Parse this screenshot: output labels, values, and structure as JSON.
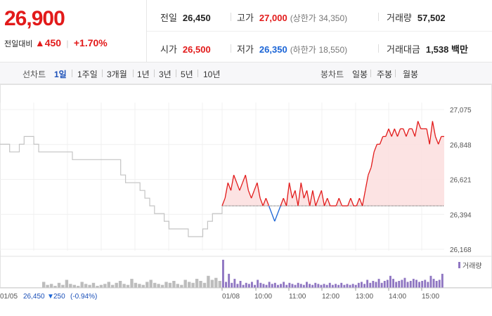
{
  "quote": {
    "current_price": "26,900",
    "change_label": "전일대비",
    "change_arrow": "▲",
    "change_value": "450",
    "change_pct": "+1.70%",
    "prev_close_label": "전일",
    "prev_close": "26,450",
    "high_label": "고가",
    "high": "27,000",
    "upper_limit_label": "(상한가",
    "upper_limit": "34,350)",
    "volume_label": "거래량",
    "volume": "57,502",
    "open_label": "시가",
    "open": "26,500",
    "low_label": "저가",
    "low": "26,350",
    "lower_limit_label": "(하한가",
    "lower_limit": "18,550)",
    "trade_value_label": "거래대금",
    "trade_value": "1,538 백만"
  },
  "tabs": {
    "line_label": "선차트",
    "line_items": [
      "1일",
      "1주일",
      "3개월",
      "1년",
      "3년",
      "5년",
      "10년"
    ],
    "active": "1일",
    "candle_label": "봉차트",
    "candle_items": [
      "일봉",
      "주봉",
      "월봉"
    ]
  },
  "colors": {
    "up": "#e21a1a",
    "down": "#1a64d6",
    "prev_day_line": "#c4c4c4",
    "volume_today": "#8f76c2",
    "volume_prev": "#bdbdbd",
    "fill_up": "#fbdede"
  },
  "chart_data": {
    "type": "line",
    "y_ticks": [
      "27,075",
      "26,848",
      "26,621",
      "26,394",
      "26,168"
    ],
    "ylim": [
      26168,
      27075
    ],
    "reference_price": 26450,
    "x_tick_labels": [
      "01/05",
      "01/08",
      "10:00",
      "11:00",
      "12:00",
      "13:00",
      "14:00",
      "15:00"
    ],
    "prev_day_summary": {
      "date": "01/05",
      "close": "26,450",
      "arrow": "▼",
      "change": "250",
      "pct": "(-0.94%)"
    },
    "volume_legend": "거래량",
    "prev_day_price": [
      26850,
      26850,
      26800,
      26800,
      26850,
      26900,
      26900,
      26850,
      26800,
      26800,
      26800,
      26800,
      26800,
      26800,
      26800,
      26750,
      26750,
      26750,
      26750,
      26750,
      26750,
      26750,
      26750,
      26750,
      26750,
      26650,
      26600,
      26600,
      26600,
      26550,
      26500,
      26450,
      26400,
      26400,
      26350,
      26300,
      26300,
      26300,
      26300,
      26250,
      26250,
      26250,
      26300,
      26350,
      26400,
      26400,
      26450
    ],
    "today_series": {
      "times": [
        "09:00",
        "09:05",
        "09:10",
        "09:15",
        "09:20",
        "09:25",
        "09:30",
        "09:35",
        "09:40",
        "09:45",
        "09:50",
        "09:55",
        "10:00",
        "10:05",
        "10:10",
        "10:15",
        "10:20",
        "10:25",
        "10:30",
        "10:35",
        "10:40",
        "10:45",
        "10:50",
        "10:55",
        "11:00",
        "11:05",
        "11:10",
        "11:15",
        "11:20",
        "11:25",
        "11:30",
        "11:35",
        "11:40",
        "11:45",
        "11:50",
        "11:55",
        "12:00",
        "12:05",
        "12:10",
        "12:15",
        "12:20",
        "12:25",
        "12:30",
        "12:35",
        "12:40",
        "12:45",
        "12:50",
        "12:55",
        "13:00",
        "13:05",
        "13:10",
        "13:15",
        "13:20",
        "13:25",
        "13:30",
        "13:35",
        "13:40",
        "13:45",
        "13:50",
        "13:55",
        "14:00",
        "14:05",
        "14:10",
        "14:15",
        "14:20",
        "14:25",
        "14:30",
        "14:35",
        "14:40",
        "14:45",
        "14:50",
        "14:55",
        "15:00",
        "15:05",
        "15:10",
        "15:15",
        "15:20"
      ],
      "price": [
        26450,
        26500,
        26600,
        26550,
        26650,
        26600,
        26550,
        26600,
        26650,
        26550,
        26500,
        26550,
        26600,
        26500,
        26450,
        26500,
        26450,
        26400,
        26350,
        26400,
        26450,
        26500,
        26450,
        26600,
        26500,
        26550,
        26450,
        26600,
        26500,
        26550,
        26450,
        26550,
        26450,
        26500,
        26550,
        26450,
        26500,
        26450,
        26450,
        26450,
        26500,
        26450,
        26450,
        26450,
        26500,
        26450,
        26450,
        26500,
        26450,
        26550,
        26650,
        26700,
        26800,
        26850,
        26850,
        26900,
        26900,
        26950,
        26900,
        26950,
        26900,
        26950,
        26950,
        26900,
        26950,
        26950,
        26900,
        27000,
        26950,
        26950,
        26950,
        26850,
        27000,
        26900,
        26850,
        26900,
        26900
      ]
    },
    "volume_prev": [
      6,
      3,
      4,
      2,
      5,
      3,
      8,
      4,
      3,
      2,
      6,
      4,
      3,
      5,
      2,
      3,
      4,
      6,
      3,
      5,
      7,
      4,
      3,
      9,
      5,
      4,
      3,
      6,
      8,
      5,
      4,
      3,
      6,
      5,
      7,
      4,
      3,
      8,
      6,
      5,
      9,
      7,
      5,
      12,
      8,
      10,
      7
    ],
    "volume_today": [
      28,
      6,
      14,
      5,
      9,
      4,
      7,
      3,
      5,
      4,
      6,
      3,
      8,
      5,
      4,
      3,
      6,
      4,
      5,
      3,
      4,
      6,
      3,
      5,
      4,
      3,
      5,
      4,
      3,
      6,
      4,
      3,
      5,
      4,
      3,
      4,
      3,
      5,
      3,
      4,
      3,
      5,
      3,
      4,
      3,
      4,
      3,
      5,
      6,
      4,
      8,
      5,
      7,
      6,
      9,
      5,
      7,
      8,
      12,
      9,
      6,
      7,
      8,
      10,
      6,
      7,
      9,
      8,
      6,
      7,
      8,
      6,
      12,
      9,
      7,
      8,
      14
    ]
  }
}
